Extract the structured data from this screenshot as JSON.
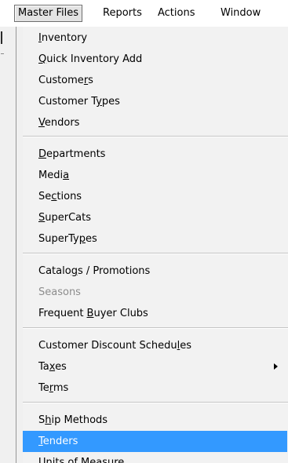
{
  "menubar": {
    "items": [
      {
        "label": "Master Files",
        "active": true
      },
      {
        "label": "Reports",
        "active": false
      },
      {
        "label": "Actions",
        "active": false
      },
      {
        "label": "Window",
        "active": false
      }
    ]
  },
  "menu": {
    "items": [
      {
        "pre": "",
        "acc": "I",
        "post": "nventory"
      },
      {
        "pre": "",
        "acc": "Q",
        "post": "uick Inventory Add"
      },
      {
        "pre": "Custome",
        "acc": "r",
        "post": "s"
      },
      {
        "pre": "Customer T",
        "acc": "y",
        "post": "pes"
      },
      {
        "pre": "",
        "acc": "V",
        "post": "endors"
      },
      {
        "pre": "",
        "acc": "D",
        "post": "epartments"
      },
      {
        "pre": "Medi",
        "acc": "a",
        "post": ""
      },
      {
        "pre": "Se",
        "acc": "c",
        "post": "tions"
      },
      {
        "pre": "",
        "acc": "S",
        "post": "uperCats"
      },
      {
        "pre": "SuperTy",
        "acc": "p",
        "post": "es"
      },
      {
        "pre": "Catalo",
        "acc": "g",
        "post": "s / Promotions"
      },
      {
        "pre": "Seasons",
        "acc": "",
        "post": ""
      },
      {
        "pre": "Frequent ",
        "acc": "B",
        "post": "uyer Clubs"
      },
      {
        "pre": "Customer Discount Schedu",
        "acc": "l",
        "post": "es"
      },
      {
        "pre": "Ta",
        "acc": "x",
        "post": "es"
      },
      {
        "pre": "Te",
        "acc": "r",
        "post": "ms"
      },
      {
        "pre": "S",
        "acc": "h",
        "post": "ip Methods"
      },
      {
        "pre": "",
        "acc": "T",
        "post": "enders"
      },
      {
        "pre": "",
        "acc": "U",
        "post": "nits of Measure"
      }
    ]
  }
}
